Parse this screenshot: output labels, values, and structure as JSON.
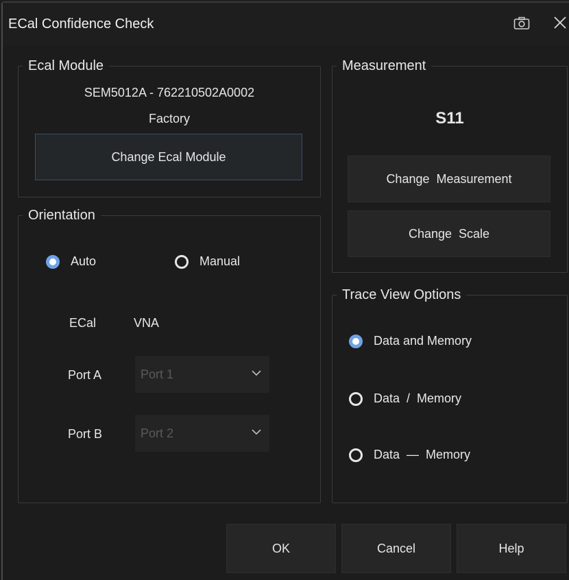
{
  "window": {
    "title": "ECal Confidence Check"
  },
  "ecal_module": {
    "legend": "Ecal Module",
    "module_id": "SEM5012A - 762210502A0002",
    "characterization": "Factory",
    "change_button": "Change Ecal Module"
  },
  "measurement": {
    "legend": "Measurement",
    "value": "S11",
    "change_measurement_button": "Change  Measurement",
    "change_scale_button": "Change  Scale"
  },
  "orientation": {
    "legend": "Orientation",
    "auto_label": "Auto",
    "manual_label": "Manual",
    "selected": "Auto",
    "col_ecal": "ECal",
    "col_vna": "VNA",
    "port_a_label": "Port A",
    "port_a_value": "Port 1",
    "port_b_label": "Port B",
    "port_b_value": "Port 2"
  },
  "trace_view": {
    "legend": "Trace View Options",
    "option_1": "Data and Memory",
    "option_2": "Data  /  Memory",
    "option_3": "Data  —  Memory",
    "selected": "Data and Memory"
  },
  "footer": {
    "ok": "OK",
    "cancel": "Cancel",
    "help": "Help"
  },
  "icons": {
    "camera": "camera-icon",
    "close": "close-icon",
    "chevron": "chevron-down-icon"
  },
  "colors": {
    "accent": "#6fa3e6",
    "background": "#1c1c1c",
    "button": "#262626"
  }
}
